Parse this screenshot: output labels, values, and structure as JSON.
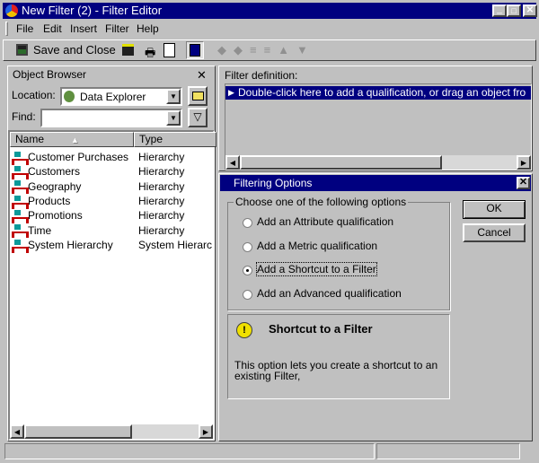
{
  "window": {
    "title": "New Filter (2) - Filter Editor"
  },
  "menu": [
    "File",
    "Edit",
    "Insert",
    "Filter",
    "Help"
  ],
  "toolbar": {
    "save_close": "Save and Close"
  },
  "object_browser": {
    "title": "Object Browser",
    "location_label": "Location:",
    "location_value": "Data Explorer",
    "find_label": "Find:",
    "find_value": "",
    "columns": [
      "Name",
      "Type"
    ],
    "rows": [
      {
        "name": "Customer Purchases",
        "type": "Hierarchy"
      },
      {
        "name": "Customers",
        "type": "Hierarchy"
      },
      {
        "name": "Geography",
        "type": "Hierarchy"
      },
      {
        "name": "Products",
        "type": "Hierarchy"
      },
      {
        "name": "Promotions",
        "type": "Hierarchy"
      },
      {
        "name": "Time",
        "type": "Hierarchy"
      },
      {
        "name": "System Hierarchy",
        "type": "System Hierarc"
      }
    ]
  },
  "filter_definition": {
    "label": "Filter definition:",
    "placeholder_row": "Double-click here to add a qualification, or drag an object fro"
  },
  "filtering_options": {
    "title": "Filtering Options",
    "group_label": "Choose one of the following options",
    "options": [
      {
        "label": "Add an Attribute qualification",
        "selected": false
      },
      {
        "label": "Add a Metric qualification",
        "selected": false
      },
      {
        "label": "Add a Shortcut to a Filter",
        "selected": true
      },
      {
        "label": "Add an Advanced qualification",
        "selected": false
      }
    ],
    "ok": "OK",
    "cancel": "Cancel",
    "info_title": "Shortcut to a Filter",
    "info_text": "This option lets you create a shortcut to an existing Filter,"
  },
  "colors": {
    "titlebar": "#000080",
    "selection": "#000080"
  }
}
